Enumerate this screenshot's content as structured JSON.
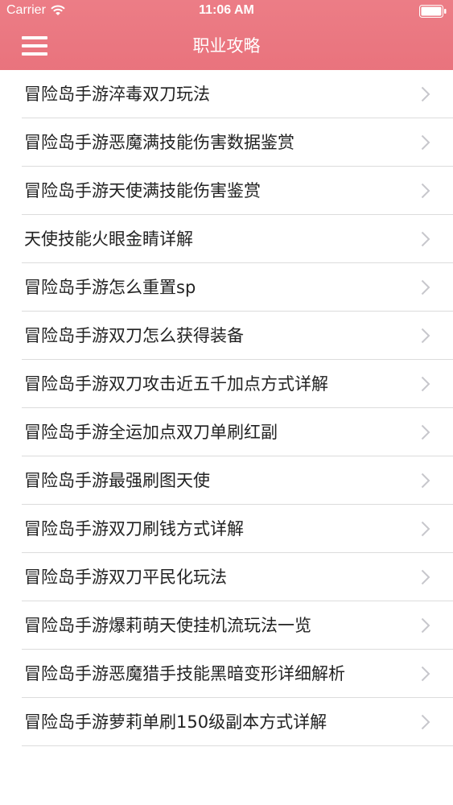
{
  "status_bar": {
    "carrier": "Carrier",
    "time": "11:06 AM"
  },
  "nav": {
    "title": "职业攻略"
  },
  "colors": {
    "header": "#e9737d",
    "divider": "#dcdcdc",
    "chevron": "#c7c7cc"
  },
  "items": [
    {
      "label": "冒险岛手游淬毒双刀玩法"
    },
    {
      "label": "冒险岛手游恶魔满技能伤害数据鉴赏"
    },
    {
      "label": "冒险岛手游天使满技能伤害鉴赏"
    },
    {
      "label": "天使技能火眼金睛详解"
    },
    {
      "label": "冒险岛手游怎么重置sp"
    },
    {
      "label": "冒险岛手游双刀怎么获得装备"
    },
    {
      "label": "冒险岛手游双刀攻击近五千加点方式详解"
    },
    {
      "label": "冒险岛手游全运加点双刀单刷红副"
    },
    {
      "label": "冒险岛手游最强刷图天使"
    },
    {
      "label": "冒险岛手游双刀刷钱方式详解"
    },
    {
      "label": "冒险岛手游双刀平民化玩法"
    },
    {
      "label": "冒险岛手游爆莉萌天使挂机流玩法一览"
    },
    {
      "label": "冒险岛手游恶魔猎手技能黑暗变形详细解析"
    },
    {
      "label": "冒险岛手游萝莉单刷150级副本方式详解"
    }
  ]
}
